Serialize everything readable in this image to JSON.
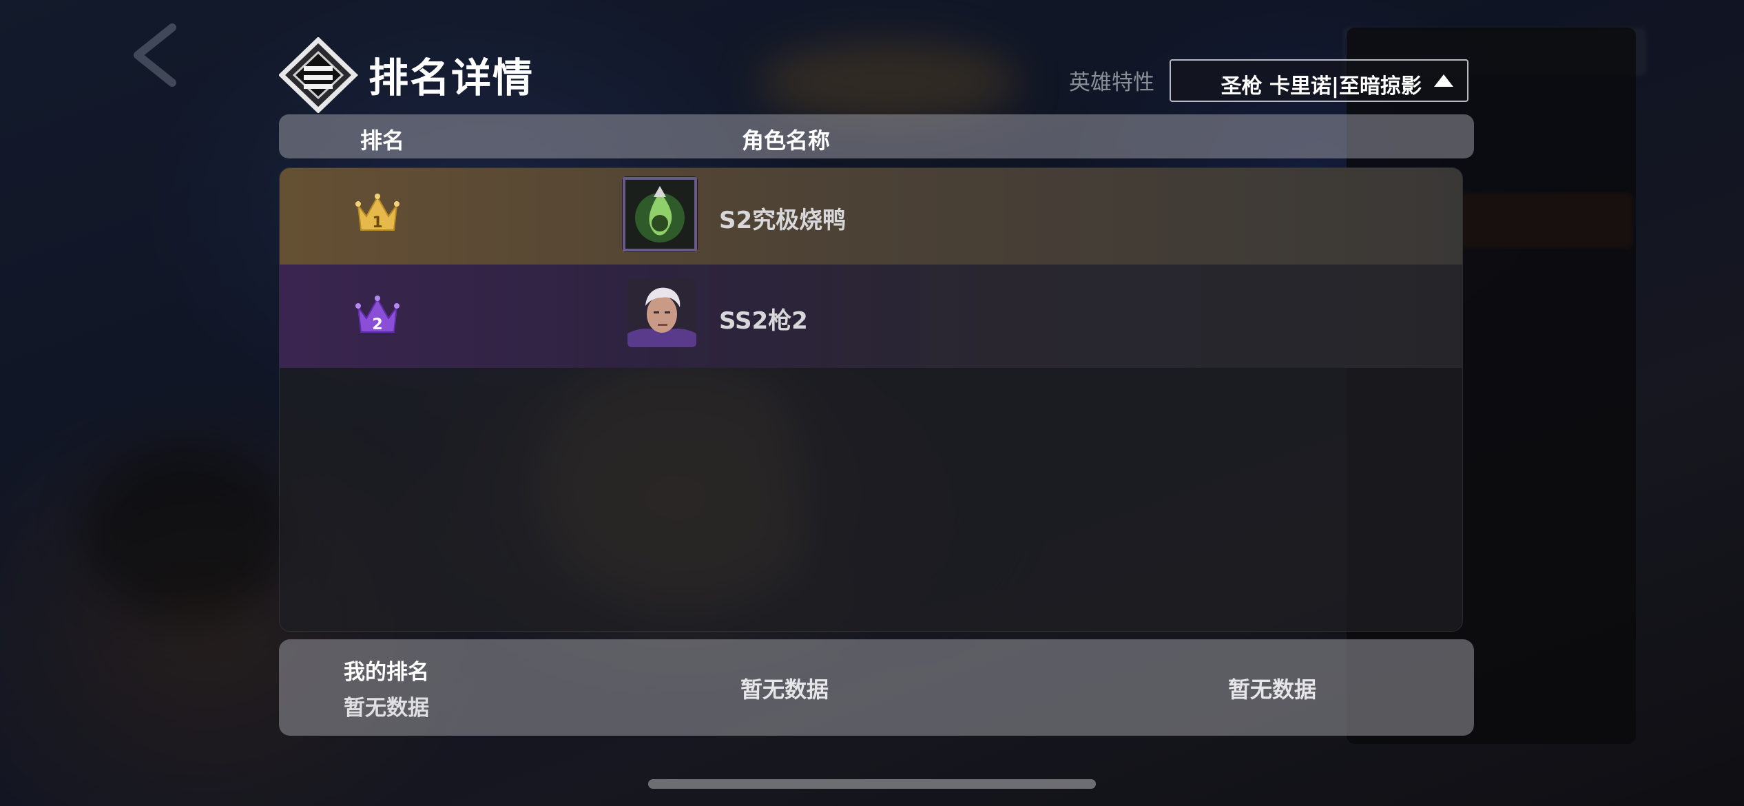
{
  "dialog": {
    "title": "排名详情",
    "filter_label": "英雄特性",
    "filter_value": "圣枪 卡里诺|至暗掠影"
  },
  "table": {
    "headers": {
      "rank": "排名",
      "role_name": "角色名称"
    },
    "rows": [
      {
        "rank": "1",
        "crown_color": "#e6b94a",
        "role_name": "S2究极烧鸭",
        "avatar": "green-flame-emblem"
      },
      {
        "rank": "2",
        "crown_color": "#8a4fd6",
        "role_name": "SS2枪2",
        "avatar": "white-haired-hero-portrait"
      }
    ]
  },
  "footer": {
    "my_rank_label": "我的排名",
    "my_rank_value": "暂无数据",
    "col2_value": "暂无数据",
    "col3_value": "暂无数据"
  },
  "colors": {
    "gold_crown": "#e6b94a",
    "purple_crown": "#8a4fd6",
    "row1_tint": "#655033",
    "row2_tint": "#3a2550"
  }
}
